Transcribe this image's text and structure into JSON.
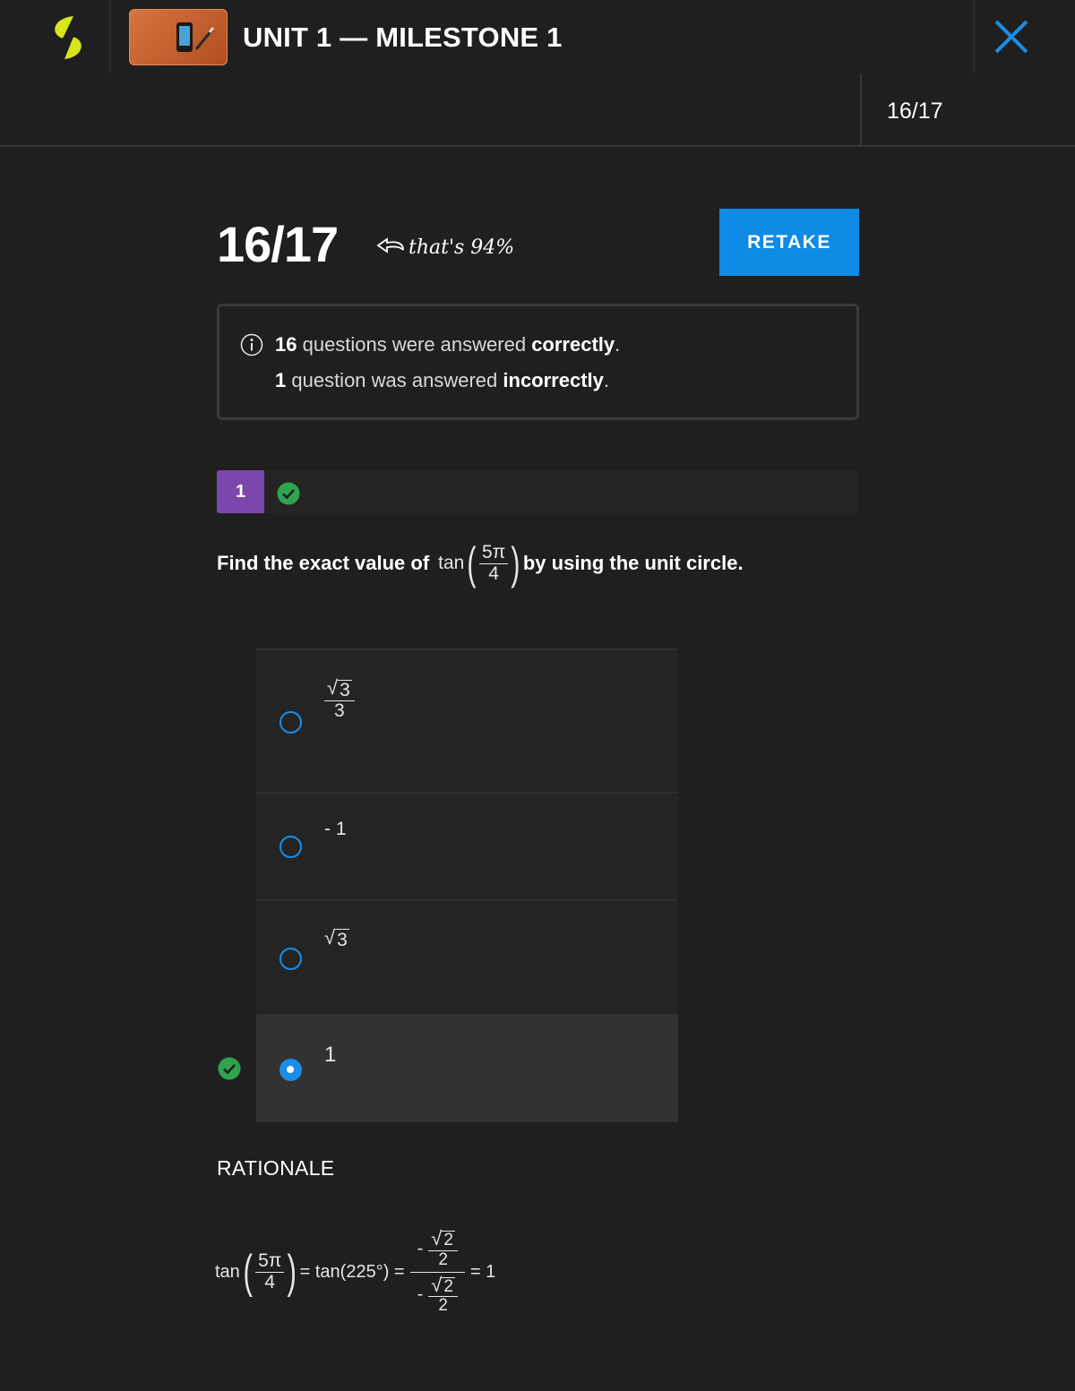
{
  "header": {
    "title": "UNIT 1 — MILESTONE 1",
    "progress": "16/17"
  },
  "score": {
    "value": "16/17",
    "note": "that's 94%",
    "retake_label": "RETAKE"
  },
  "summary": {
    "correct_count": "16",
    "correct_text": " questions were answered ",
    "correct_word": "correctly",
    "incorrect_count": "1",
    "incorrect_text": " question was answered ",
    "incorrect_word": "incorrectly",
    "period": "."
  },
  "question": {
    "number": "1",
    "prompt_before": "Find the exact value of",
    "func": "tan",
    "frac_num": "5π",
    "frac_den": "4",
    "prompt_after": "by using the unit circle."
  },
  "answers": [
    {
      "radicand": "3",
      "den": "3",
      "selected": false
    },
    {
      "text": "- 1",
      "selected": false
    },
    {
      "radicand": "3",
      "selected": false
    },
    {
      "text": "1",
      "selected": true,
      "correct": true
    }
  ],
  "rationale": {
    "label": "RATIONALE",
    "func": "tan",
    "frac_num": "5π",
    "frac_den": "4",
    "eq1": "= tan(225°) =",
    "minus": "-",
    "sqrt_radicand": "2",
    "sqrt_den": "2",
    "eq2": "= 1"
  },
  "colors": {
    "accent_blue": "#0f8be6",
    "question_purple": "#7b47ac",
    "correct_green": "#2ea44f",
    "logo_yellow": "#d7e51b"
  }
}
